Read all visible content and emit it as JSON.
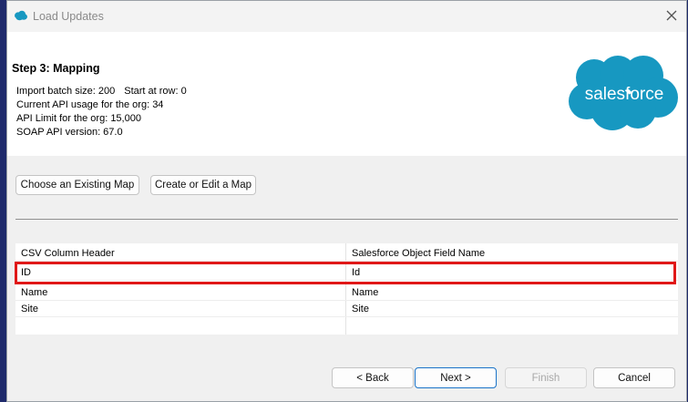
{
  "window": {
    "title": "Load Updates",
    "icon": "salesforce-cloud-icon",
    "close_icon": "close-icon"
  },
  "header": {
    "step_title": "Step 3: Mapping",
    "info": {
      "batch_size": "Import batch size: 200",
      "start_row": "Start at row: 0",
      "api_usage": "Current API usage for the org: 34",
      "api_limit": "API Limit for the org: 15,000",
      "soap_version": "SOAP API version: 67.0"
    },
    "logo_text": "salesforce",
    "brand_color": "#1798c1"
  },
  "mapping_buttons": {
    "existing_label": "Choose an Existing Map",
    "create_label": "Create or Edit a Map"
  },
  "table": {
    "headers": [
      "CSV Column Header",
      "Salesforce Object Field Name"
    ],
    "rows": [
      [
        "ID",
        "Id"
      ],
      [
        "Name",
        "Name"
      ],
      [
        "Site",
        "Site"
      ]
    ],
    "highlight_color": "#e01818"
  },
  "footer": {
    "back_label": "< Back",
    "next_label": "Next >",
    "finish_label": "Finish",
    "cancel_label": "Cancel"
  }
}
